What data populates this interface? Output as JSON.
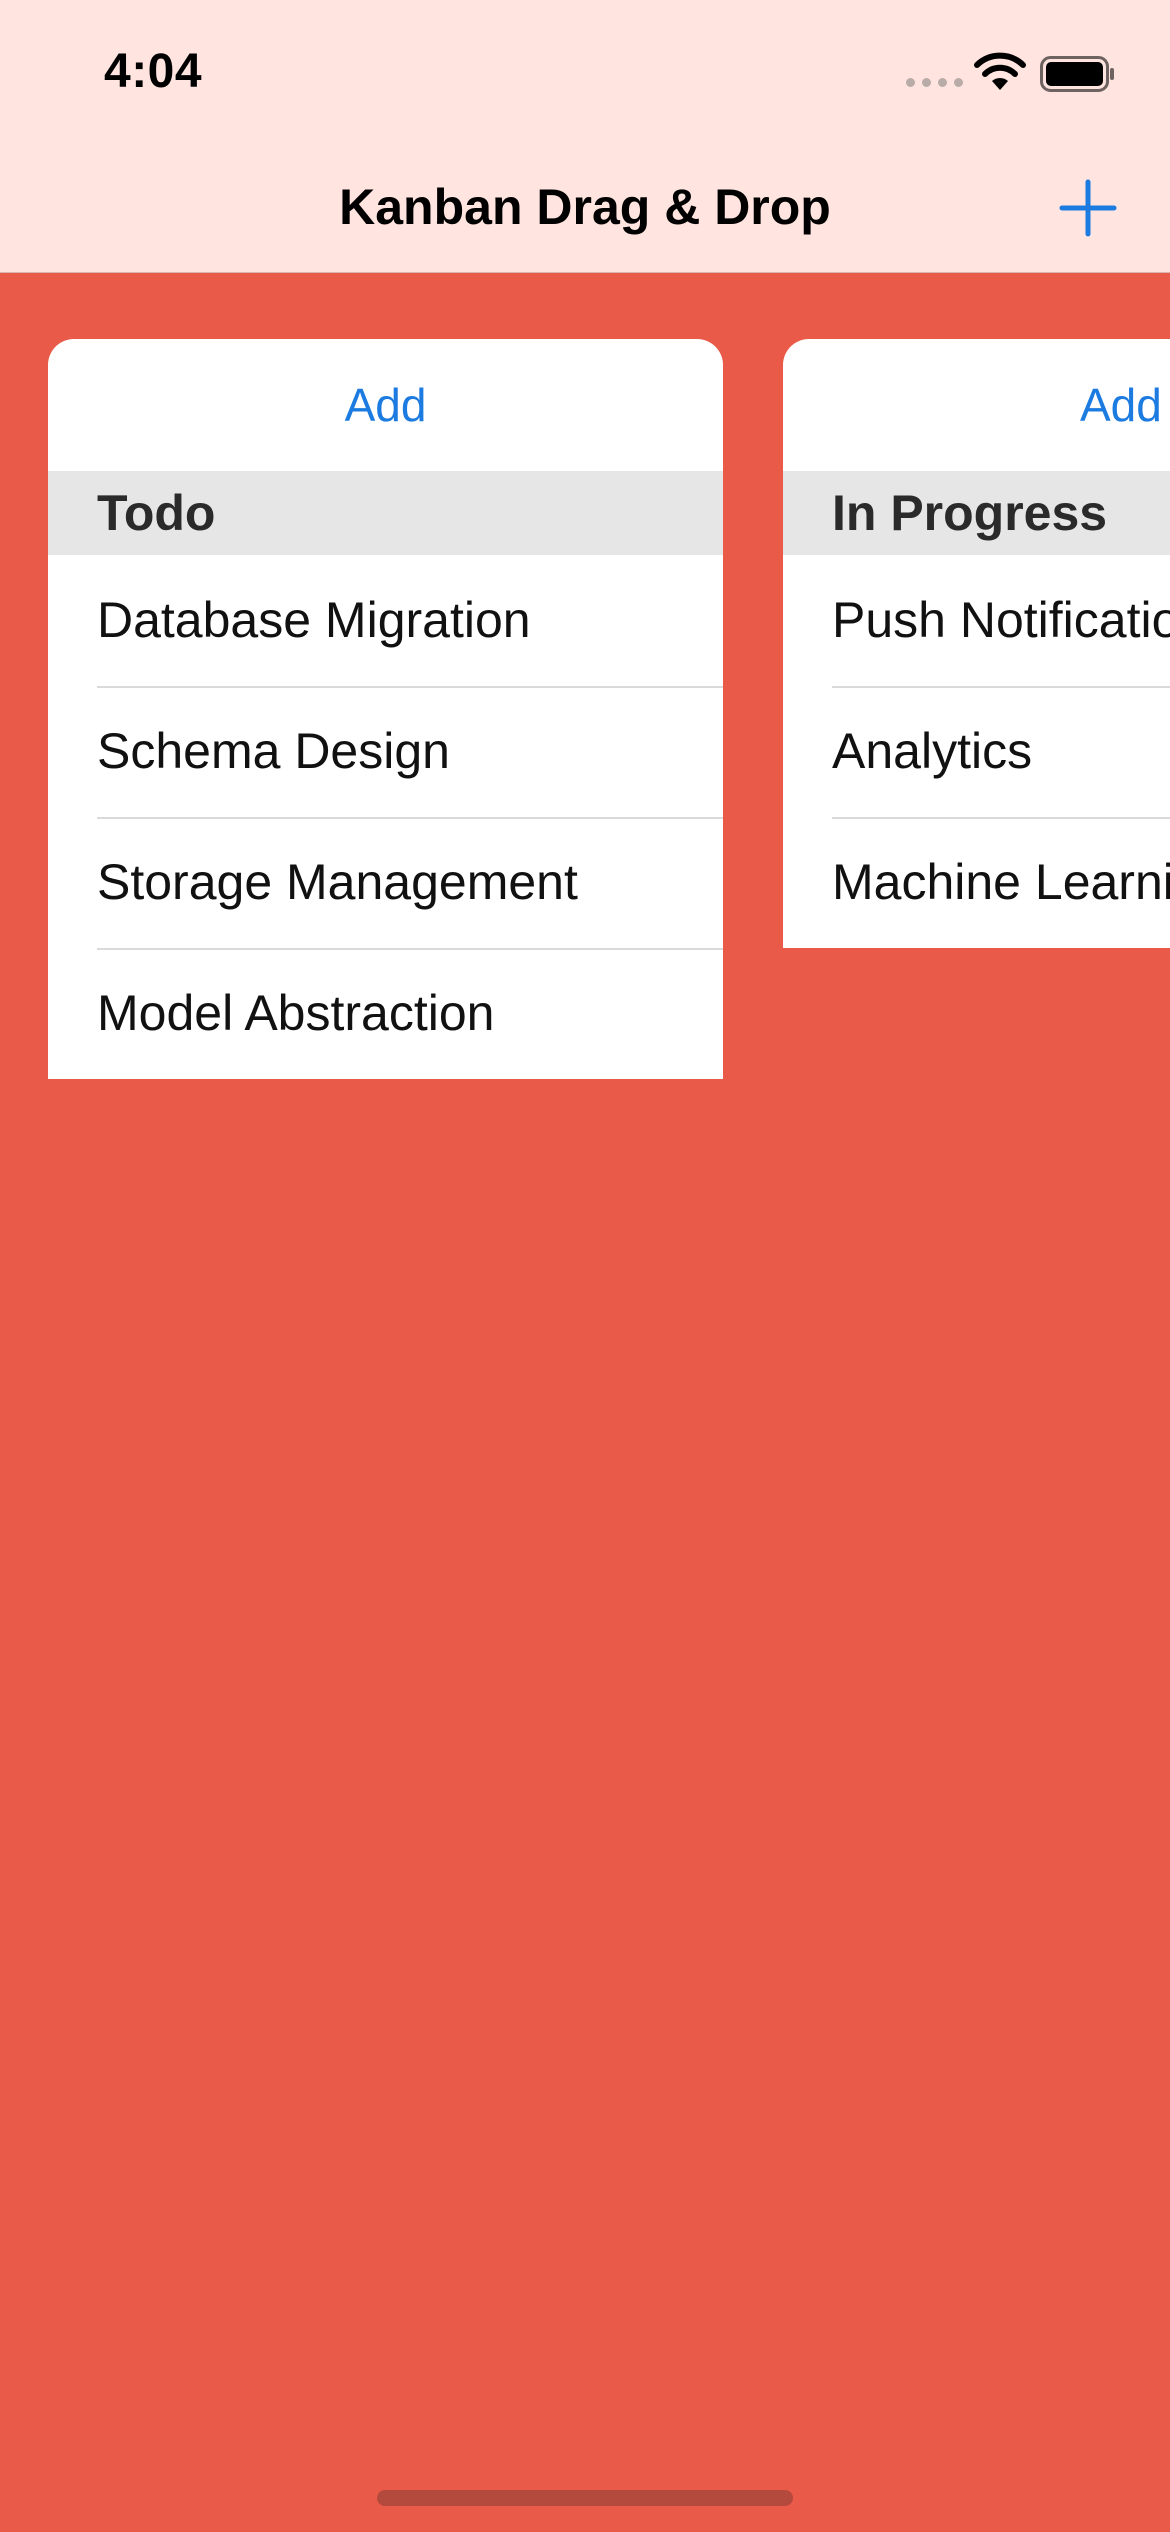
{
  "status_bar": {
    "time": "4:04"
  },
  "nav": {
    "title": "Kanban Drag & Drop",
    "add_icon": "plus-icon"
  },
  "colors": {
    "board_background": "#EA5A48",
    "nav_background": "#FFE4DF",
    "accent": "#1C7BE0",
    "header_background": "#E6E6E6"
  },
  "columns": [
    {
      "add_label": "Add",
      "title": "Todo",
      "cards": [
        "Database Migration",
        "Schema Design",
        "Storage Management",
        "Model Abstraction"
      ]
    },
    {
      "add_label": "Add",
      "title": "In Progress",
      "cards": [
        "Push Notifications",
        "Analytics",
        "Machine Learning"
      ]
    }
  ]
}
